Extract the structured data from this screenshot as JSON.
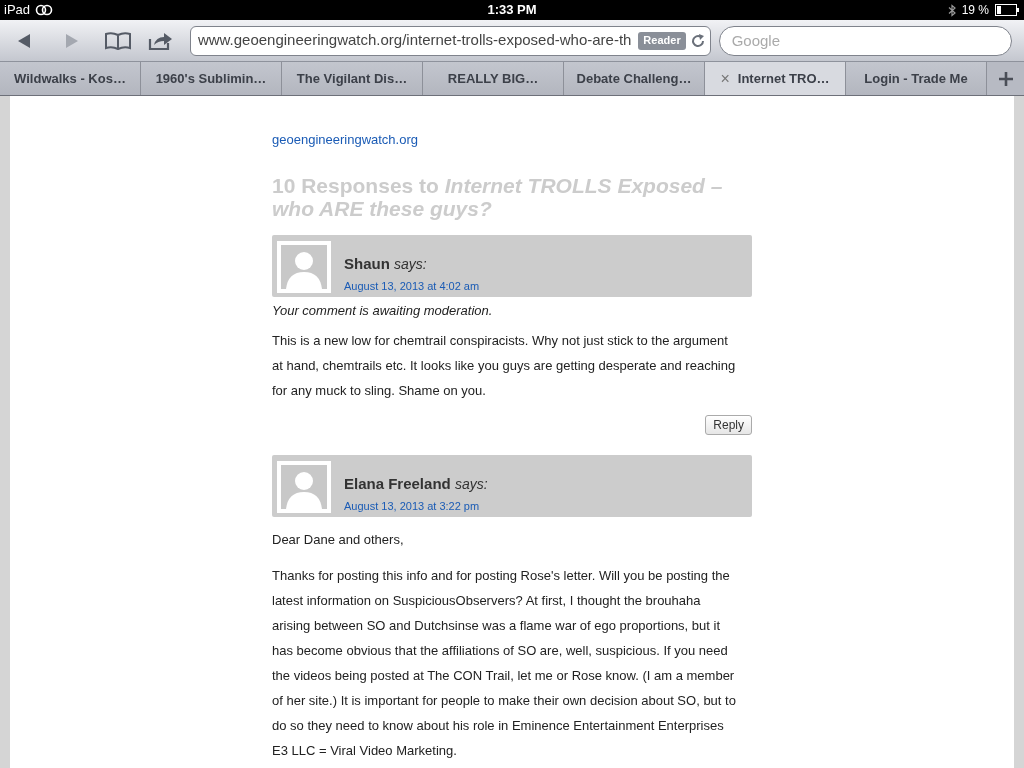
{
  "status_bar": {
    "device": "iPad",
    "time": "1:33 PM",
    "battery": "19 %"
  },
  "toolbar": {
    "url": "www.geoengineeringwatch.org/internet-trolls-exposed-who-are-th",
    "reader": "Reader",
    "search": {
      "placeholder": "Google"
    }
  },
  "tabs": [
    {
      "label": "Wildwalks - Kos…",
      "selected": false
    },
    {
      "label": "1960's Sublimin…",
      "selected": false
    },
    {
      "label": "The Vigilant Dis…",
      "selected": false
    },
    {
      "label": "REALLY BIG…",
      "selected": false
    },
    {
      "label": "Debate Challeng…",
      "selected": false
    },
    {
      "label": "Internet TRO…",
      "selected": true,
      "close": "×"
    },
    {
      "label": "Login - Trade Me",
      "selected": false
    }
  ],
  "page": {
    "source_link": "geoengineeringwatch.org",
    "heading": "10 Responses to *Internet TROLLS Exposed – who ARE these guys?*",
    "comments": [
      {
        "author": "Shaun",
        "says": "says:",
        "date": "August 13, 2013 at 4:02 am",
        "moderation": "Your comment is awaiting moderation.",
        "paragraphs": [
          "This is a new low for chemtrail conspiracists. Why not just stick to the argument at hand, chemtrails etc. It looks like you guys are getting desperate and reaching for any muck to sling. Shame on you."
        ],
        "reply": "Reply"
      },
      {
        "author": "Elana Freeland",
        "says": "says:",
        "date": "August 13, 2013 at 3:22 pm",
        "paragraphs": [
          "Dear Dane and others,",
          "Thanks for posting this info and for posting Rose's letter. Will you be posting the latest information on SuspiciousObservers? At first, I thought the brouhaha arising between SO and Dutchsinse was a flame war of ego proportions, but it has become obvious that the affiliations of SO are, well, suspicious. If you need the videos being posted at The CON Trail, let me or Rose know. (I am a member of her site.) It is important for people to make their own decision about SO, but to do so they need to know about his role in Eminence Entertainment Enterprises E3 LLC = Viral Video Marketing."
        ]
      }
    ]
  }
}
